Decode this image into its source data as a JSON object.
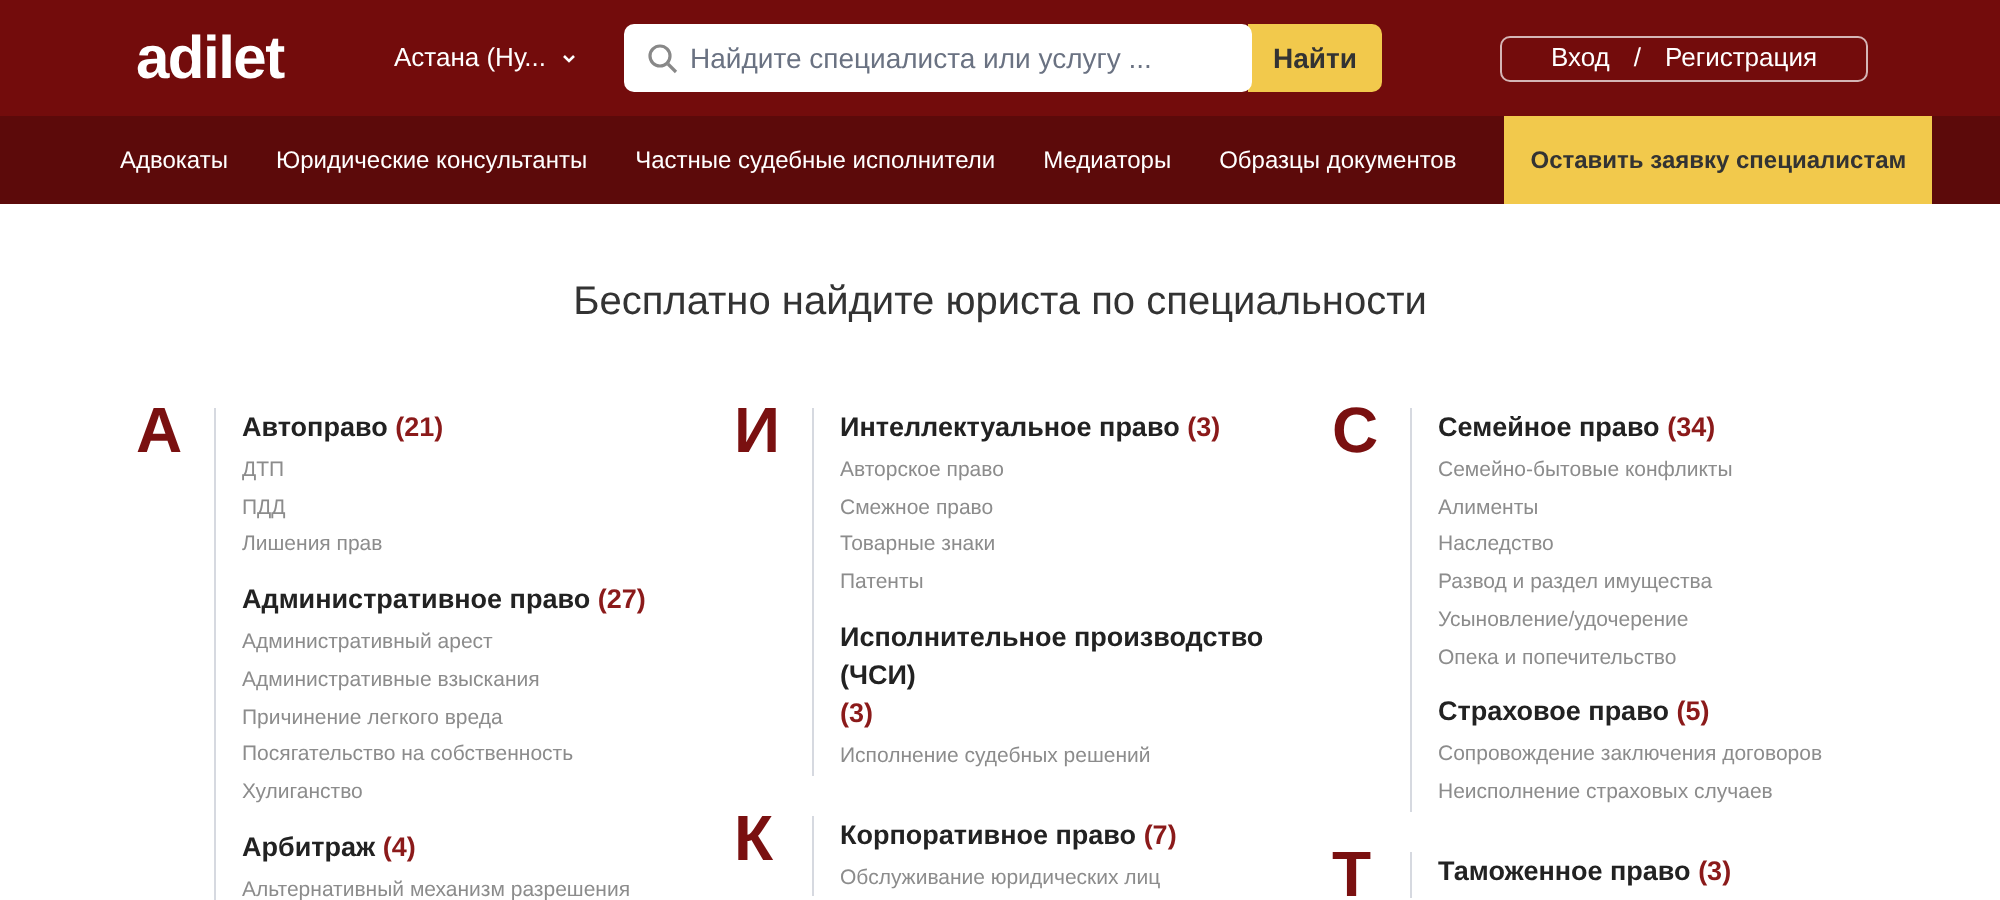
{
  "header": {
    "logo": "adilet",
    "city": "Астана (Ну...",
    "search": {
      "placeholder": "Найдите специалиста или услугу ..."
    },
    "search_button": "Найти",
    "login": "Вход",
    "separator": "/",
    "register": "Регистрация"
  },
  "nav": [
    {
      "label": "Адвокаты",
      "kind": "link"
    },
    {
      "label": "Юридические консультанты",
      "kind": "link"
    },
    {
      "label": "Частные судебные исполнители",
      "kind": "link"
    },
    {
      "label": "Медиаторы",
      "kind": "link"
    },
    {
      "label": "Образцы документов",
      "kind": "link"
    },
    {
      "label": "Оставить заявку специалистам",
      "kind": "cta"
    }
  ],
  "title": "Бесплатно найдите юриста по специальности",
  "columns": [
    [
      {
        "letter": "А",
        "groups": [
          {
            "title": "Автоправо",
            "count": "(21)",
            "items": [
              "ДТП",
              "ПДД",
              "Лишения прав"
            ]
          },
          {
            "title": "Административное право",
            "count": "(27)",
            "items": [
              "Административный арест",
              "Административные взыскания",
              "Причинение легкого вреда",
              "Посягательство на собственность",
              "Хулиганство"
            ]
          },
          {
            "title": "Арбитраж",
            "count": "(4)",
            "items": [
              "Альтернативный механизм разрешения"
            ]
          }
        ]
      }
    ],
    [
      {
        "letter": "И",
        "groups": [
          {
            "title": "Интеллектуальное право",
            "count": "(3)",
            "items": [
              "Авторское право",
              "Смежное право",
              "Товарные знаки",
              "Патенты"
            ]
          },
          {
            "title": "Исполнительное производство (ЧСИ)",
            "count": "(3)",
            "items": [
              "Исполнение судебных решений"
            ]
          }
        ]
      },
      {
        "letter": "К",
        "groups": [
          {
            "title": "Корпоративное право",
            "count": "(7)",
            "items": [
              "Обслуживание юридических лиц"
            ]
          }
        ]
      }
    ],
    [
      {
        "letter": "С",
        "groups": [
          {
            "title": "Семейное право",
            "count": "(34)",
            "items": [
              "Семейно-бытовые конфликты",
              "Алименты",
              "Наследство",
              "Развод и раздел имущества",
              "Усыновление/удочерение",
              "Опека и попечительство"
            ]
          },
          {
            "title": "Страховое право",
            "count": "(5)",
            "items": [
              "Сопровождение заключения договоров",
              "Неисполнение страховых случаев"
            ]
          }
        ]
      },
      {
        "letter": "Т",
        "groups": [
          {
            "title": "Таможенное право",
            "count": "(3)"
          }
        ]
      }
    ]
  ]
}
